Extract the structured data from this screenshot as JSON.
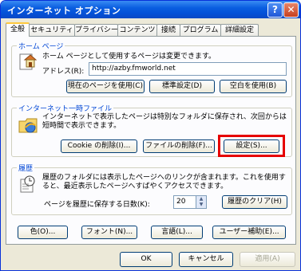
{
  "window": {
    "title": "インターネット オプション",
    "help_glyph": "?",
    "close_glyph": "✕"
  },
  "tabs": [
    "全般",
    "セキュリティ",
    "プライバシー",
    "コンテンツ",
    "接続",
    "プログラム",
    "詳細設定"
  ],
  "home": {
    "title": "ホーム ページ",
    "desc": "ホーム ページとして使用するページは変更できます。",
    "address_label": "アドレス(R):",
    "address_value": "http://azby.fmworld.net",
    "buttons": [
      "現在のページを使用(C)",
      "標準設定(D)",
      "空白を使用(B)"
    ]
  },
  "temp": {
    "title": "インターネット一時ファイル",
    "desc1": "インターネットで表示したページは特別なフォルダに保存され、次回からは",
    "desc2": "短時間で表示できます。",
    "buttons": [
      "Cookie の削除(I)...",
      "ファイルの削除(F)...",
      "設定(S)..."
    ]
  },
  "history": {
    "title": "履歴",
    "desc1": "履歴のフォルダには表示したページへのリンクが含まれます。これを使用す",
    "desc2": "ると、最近表示したページへすばやくアクセスできます。",
    "days_label": "ページを履歴に保存する日数(K):",
    "days_value": "20",
    "clear_button": "履歴のクリア(H)"
  },
  "bottom_buttons": [
    "色(O)...",
    "フォント(N)...",
    "言語(L)...",
    "ユーザー補助(E)..."
  ],
  "dialog_buttons": {
    "ok": "OK",
    "cancel": "キャンセル",
    "apply": "適用(A)"
  },
  "colors": {
    "group_title": "#0046d5",
    "highlight": "#e60000",
    "titlebar": "#0a5ee0"
  }
}
